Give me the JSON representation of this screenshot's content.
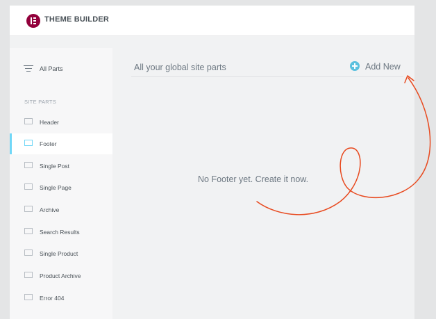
{
  "app": {
    "title": "THEME BUILDER",
    "logo_icon": "elementor-logo-icon",
    "brand_color": "#92003b"
  },
  "sidebar": {
    "all_parts_label": "All Parts",
    "section_label": "SITE PARTS",
    "items": [
      {
        "label": "Header",
        "icon": "header-template-icon",
        "active": false
      },
      {
        "label": "Footer",
        "icon": "footer-template-icon",
        "active": true
      },
      {
        "label": "Single Post",
        "icon": "single-post-icon",
        "active": false
      },
      {
        "label": "Single Page",
        "icon": "single-page-icon",
        "active": false
      },
      {
        "label": "Archive",
        "icon": "archive-icon",
        "active": false
      },
      {
        "label": "Search Results",
        "icon": "search-results-icon",
        "active": false
      },
      {
        "label": "Single Product",
        "icon": "single-product-icon",
        "active": false
      },
      {
        "label": "Product Archive",
        "icon": "product-archive-icon",
        "active": false
      },
      {
        "label": "Error 404",
        "icon": "error-404-icon",
        "active": false
      }
    ],
    "active_color": "#71d7f7"
  },
  "main": {
    "title": "All your global site parts",
    "add_new_label": "Add New",
    "add_icon_color": "#5bc0de",
    "empty_message": "No Footer yet. Create it now.",
    "annotation_color": "#e8491e"
  }
}
